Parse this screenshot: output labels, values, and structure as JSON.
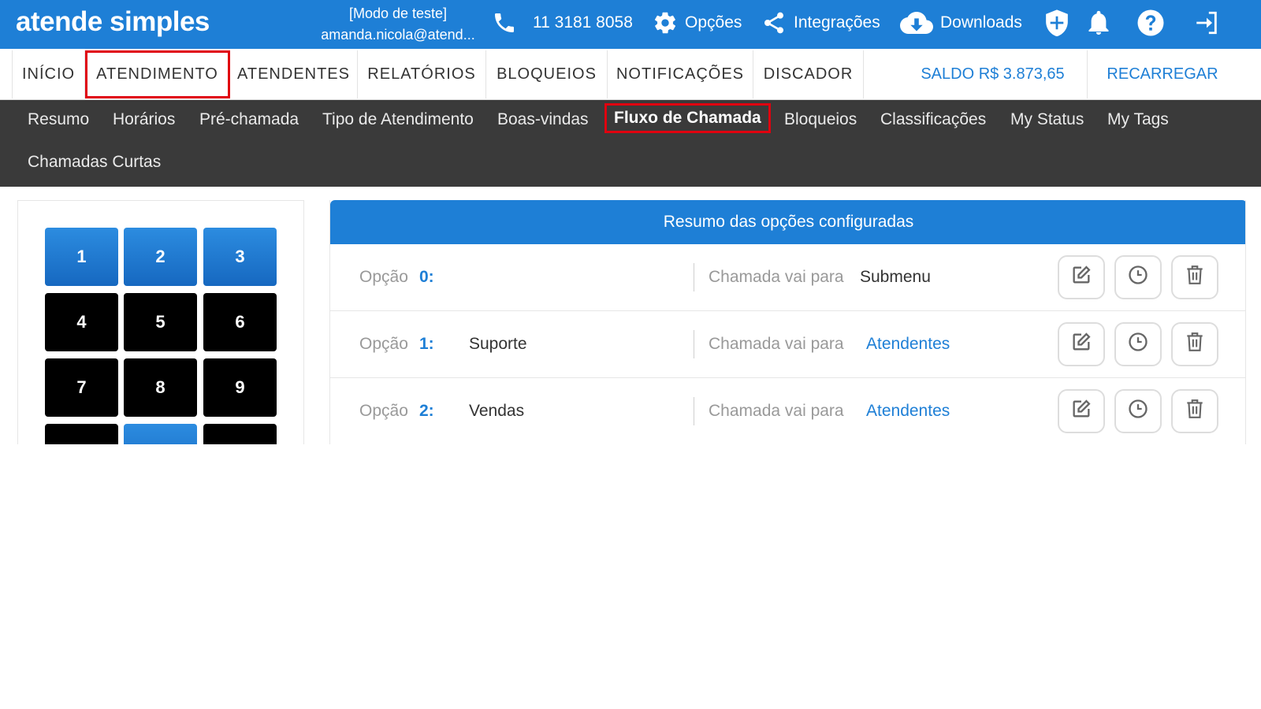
{
  "app": {
    "logo": "atende simples",
    "mode_label": "[Modo de teste]",
    "user_email": "amanda.nicola@atend...",
    "phone": "11 3181 8058",
    "options_label": "Opções",
    "integrations_label": "Integrações",
    "downloads_label": "Downloads",
    "accent_color": "#1e7fd6",
    "highlight_color": "#e0000f"
  },
  "nav": {
    "items": [
      {
        "label": "INÍCIO"
      },
      {
        "label": "ATENDIMENTO"
      },
      {
        "label": "ATENDENTES"
      },
      {
        "label": "RELATÓRIOS"
      },
      {
        "label": "BLOQUEIOS"
      },
      {
        "label": "NOTIFICAÇÕES"
      },
      {
        "label": "DISCADOR"
      }
    ],
    "selected": "ATENDIMENTO",
    "balance": "SALDO R$ 3.873,65",
    "recharge": "RECARREGAR"
  },
  "subnav": {
    "items": [
      {
        "label": "Resumo"
      },
      {
        "label": "Horários"
      },
      {
        "label": "Pré-chamada"
      },
      {
        "label": "Tipo de Atendimento"
      },
      {
        "label": "Boas-vindas"
      },
      {
        "label": "Fluxo de Chamada"
      },
      {
        "label": "Bloqueios"
      },
      {
        "label": "Classificações"
      },
      {
        "label": "My Status"
      },
      {
        "label": "My Tags"
      },
      {
        "label": "Chamadas Curtas"
      }
    ],
    "active": "Fluxo de Chamada"
  },
  "keypad": {
    "keys": [
      "1",
      "2",
      "3",
      "4",
      "5",
      "6",
      "7",
      "8",
      "9"
    ]
  },
  "options": {
    "title": "Resumo das opções configuradas",
    "option_word": "Opção",
    "goes_to_label": "Chamada vai para",
    "rows": [
      {
        "number": "0:",
        "name": "",
        "destination": "Submenu"
      },
      {
        "number": "1:",
        "name": "Suporte",
        "destination": "Atendentes"
      },
      {
        "number": "2:",
        "name": "Vendas",
        "destination": "Atendentes"
      }
    ]
  }
}
